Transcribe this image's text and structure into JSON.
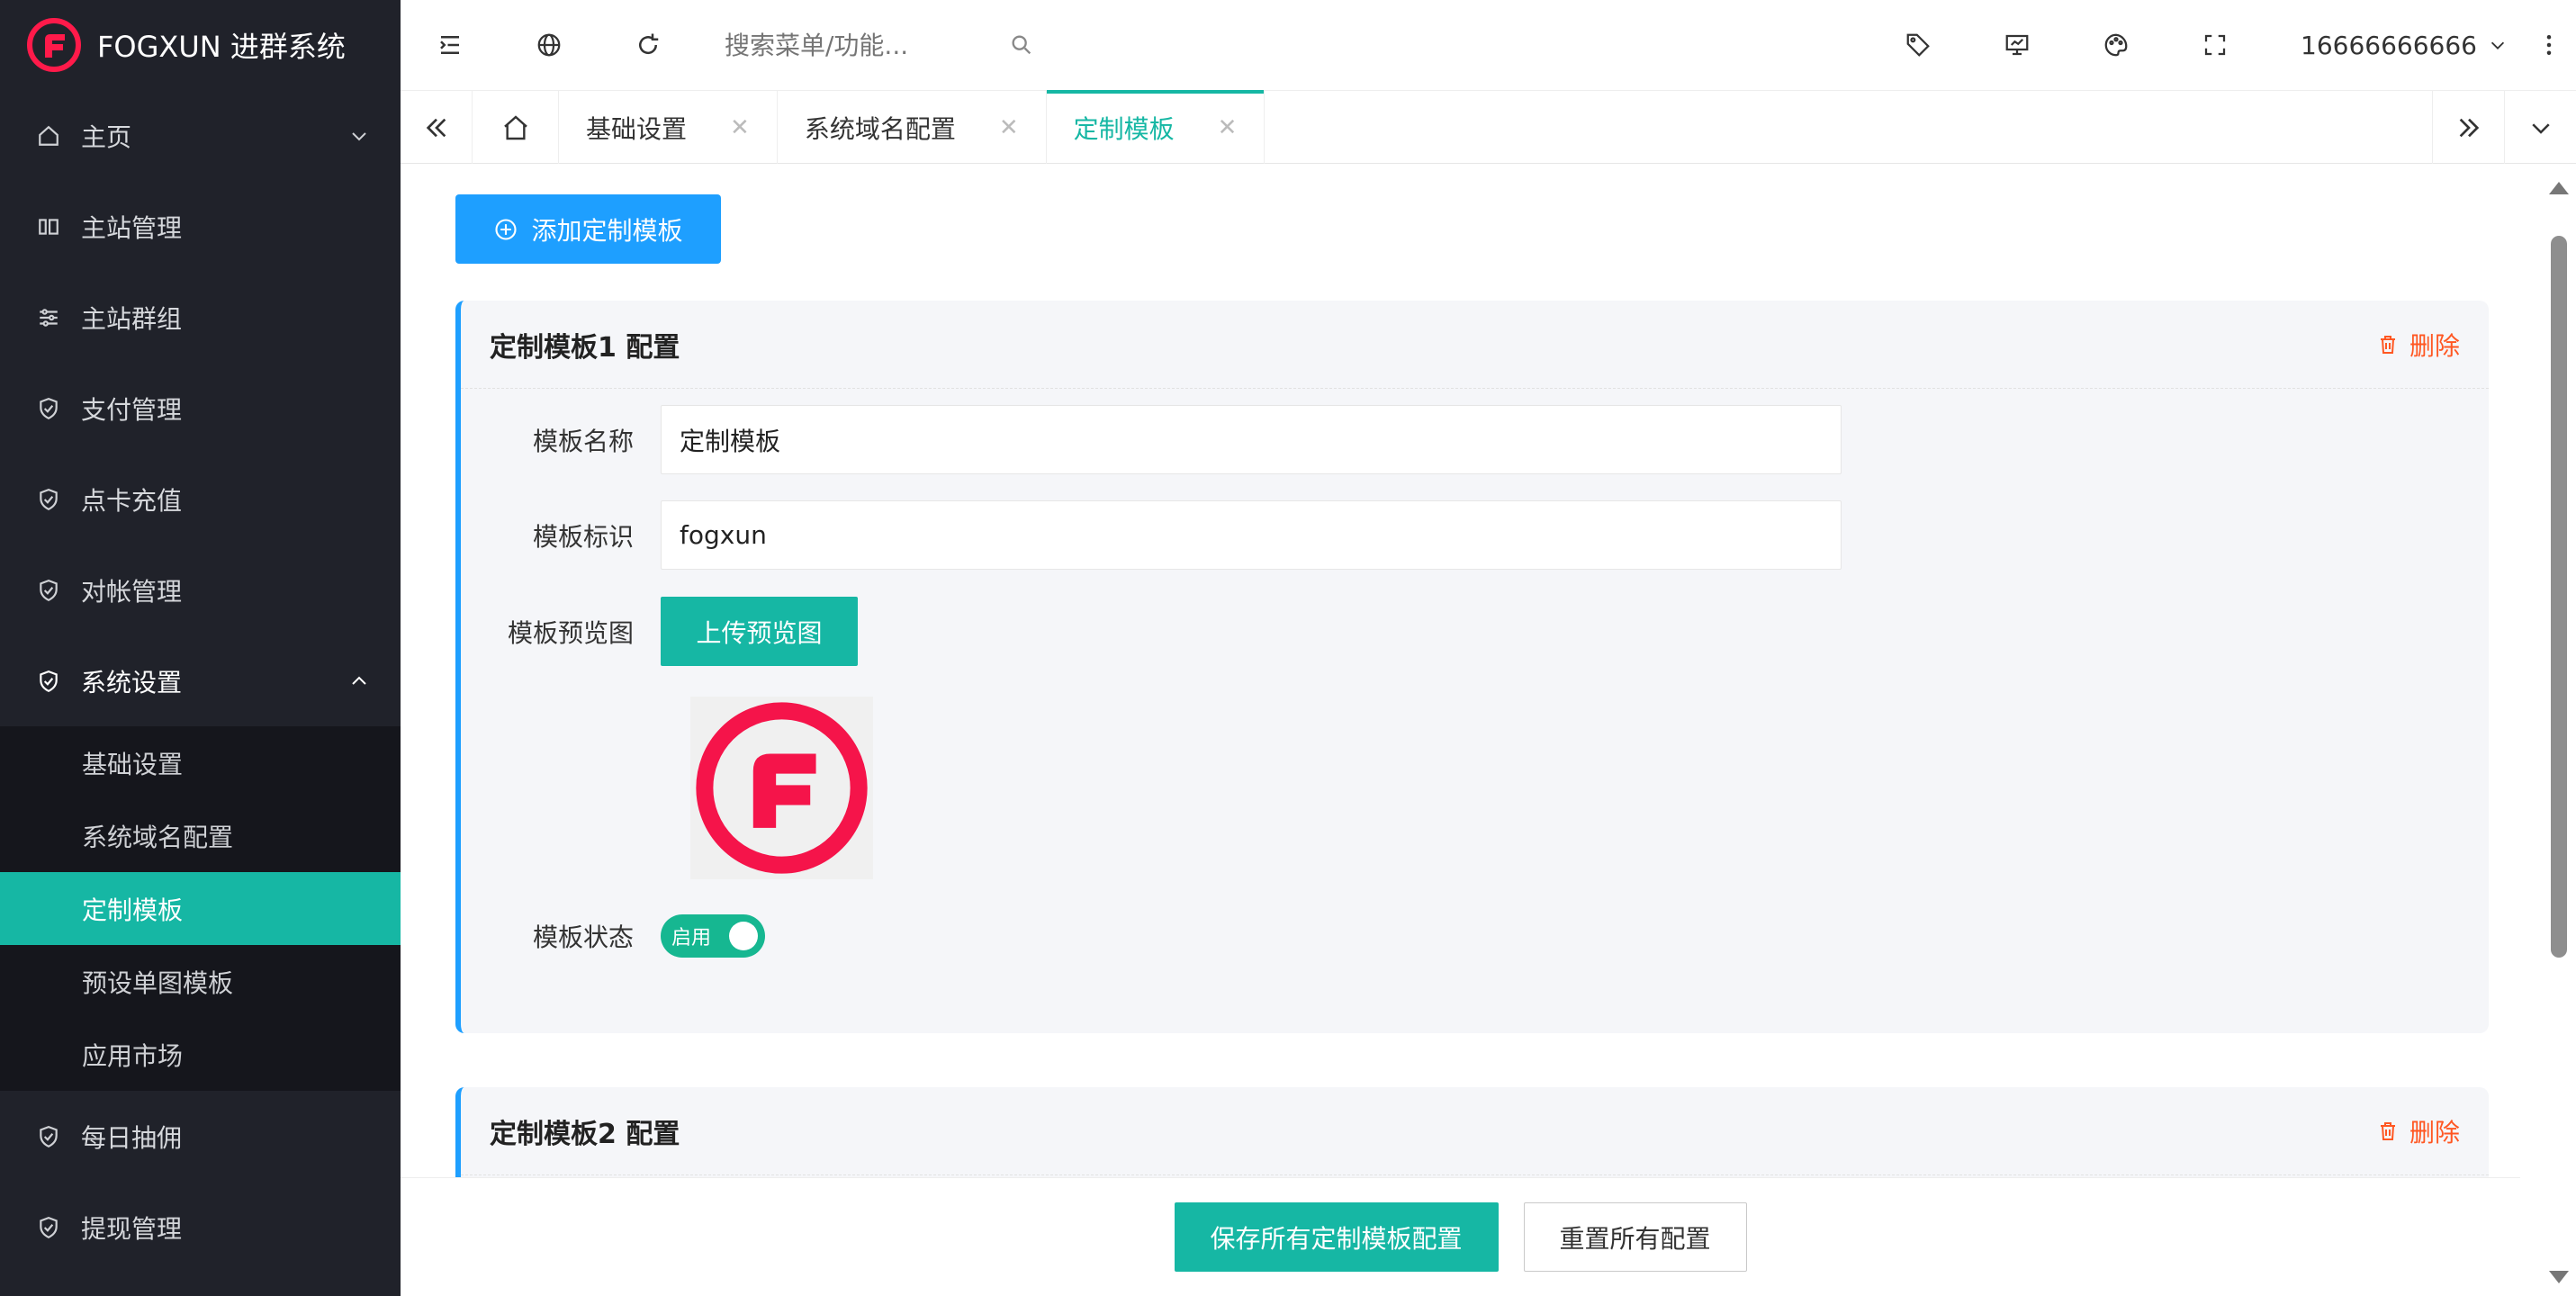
{
  "app": {
    "title": "FOGXUN 进群系统"
  },
  "colors": {
    "accent": "#16b7a4",
    "primary": "#1e9fff",
    "danger": "#ff5722",
    "sidebar": "#20222a"
  },
  "sidebar": {
    "items": [
      {
        "label": "主页",
        "icon": "home-icon"
      },
      {
        "label": "主站管理",
        "icon": "columns-icon"
      },
      {
        "label": "主站群组",
        "icon": "sliders-icon"
      },
      {
        "label": "支付管理",
        "icon": "shield-icon"
      },
      {
        "label": "点卡充值",
        "icon": "shield-icon"
      },
      {
        "label": "对帐管理",
        "icon": "shield-icon"
      },
      {
        "label": "系统设置",
        "icon": "shield-icon"
      },
      {
        "label": "每日抽佣",
        "icon": "shield-icon"
      },
      {
        "label": "提现管理",
        "icon": "shield-icon"
      }
    ],
    "submenu": [
      "基础设置",
      "系统域名配置",
      "定制模板",
      "预设单图模板",
      "应用市场"
    ]
  },
  "header": {
    "search_placeholder": "搜索菜单/功能...",
    "user": "16666666666"
  },
  "tabs": [
    {
      "label": "基础设置"
    },
    {
      "label": "系统域名配置"
    },
    {
      "label": "定制模板",
      "active": true
    }
  ],
  "content": {
    "add_button": "添加定制模板",
    "cards": [
      {
        "title": "定制模板1 配置",
        "delete": "删除",
        "fields": {
          "name_label": "模板名称",
          "name_value": "定制模板",
          "key_label": "模板标识",
          "key_value": "fogxun",
          "preview_label": "模板预览图",
          "upload_button": "上传预览图",
          "status_label": "模板状态",
          "status_text": "启用"
        }
      },
      {
        "title": "定制模板2 配置",
        "delete": "删除"
      }
    ]
  },
  "footer": {
    "save_button": "保存所有定制模板配置",
    "reset_button": "重置所有配置"
  }
}
